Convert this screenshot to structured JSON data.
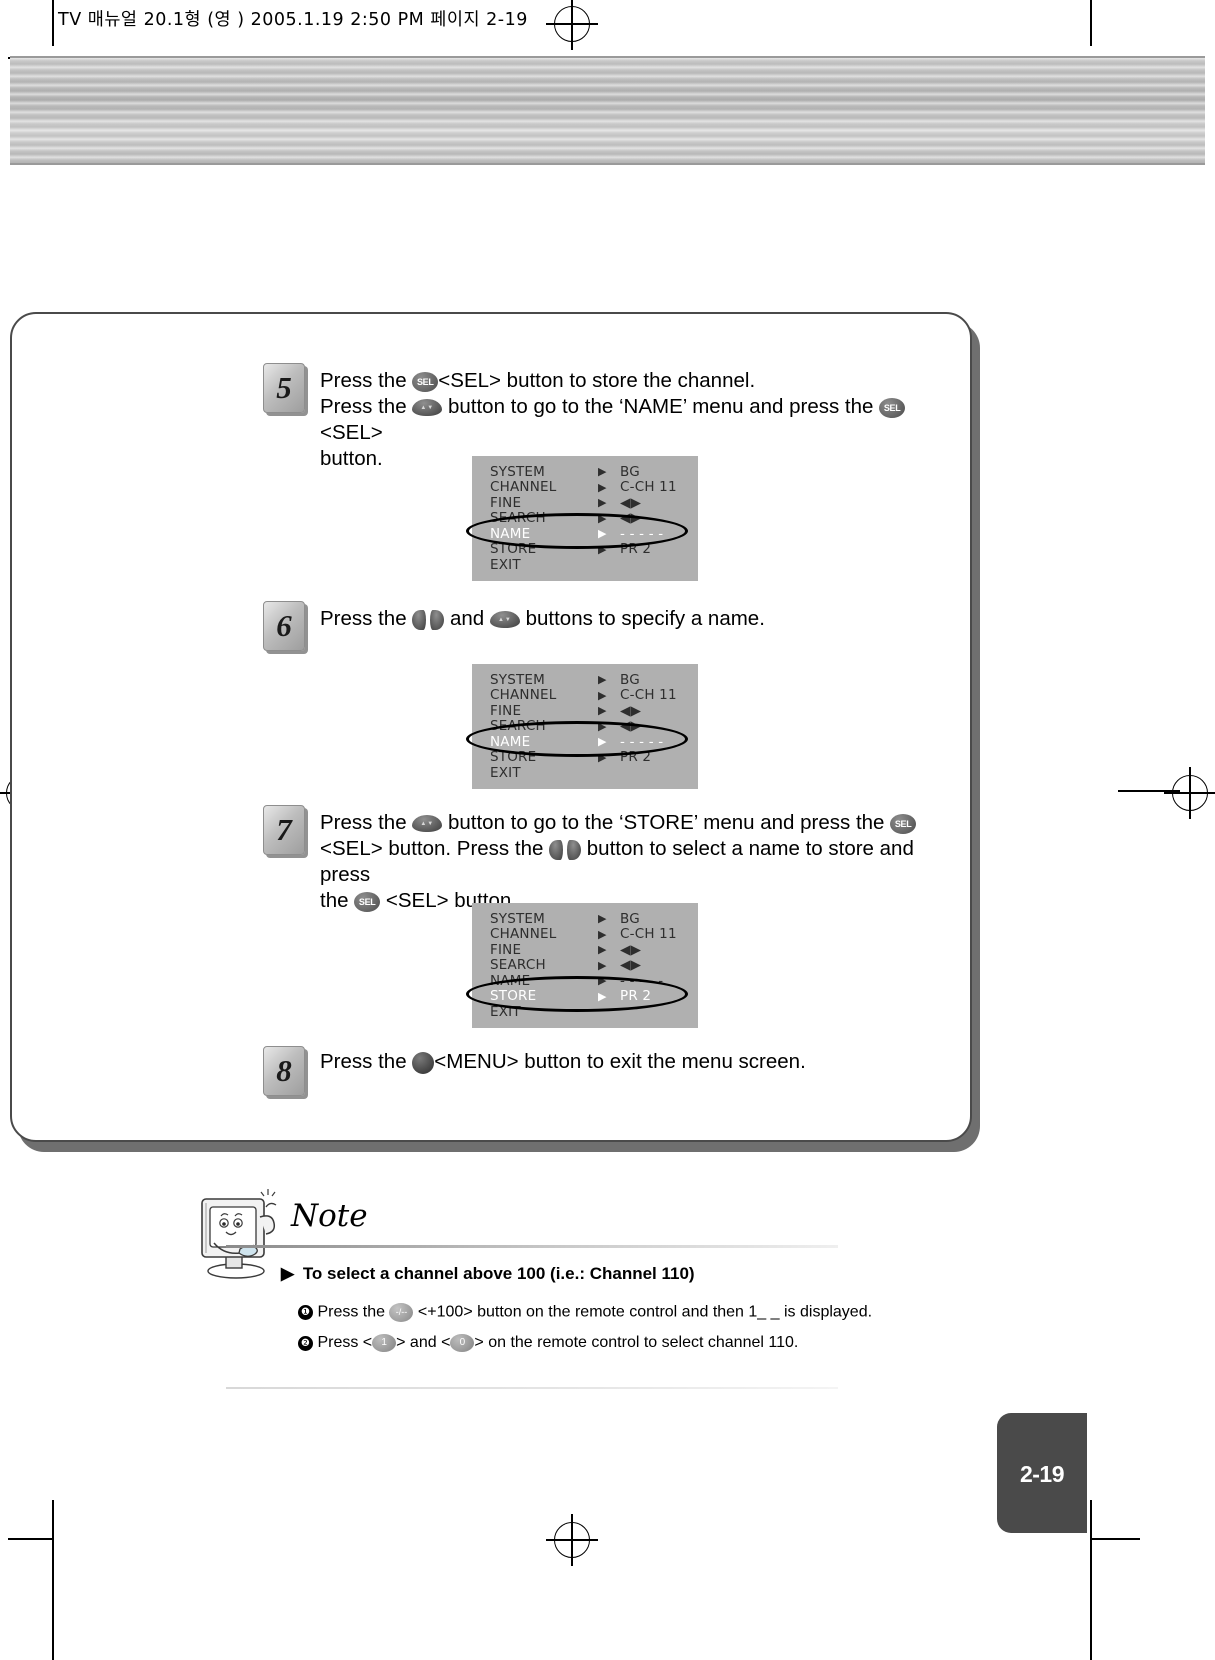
{
  "imposition": {
    "header": "TV 매뉴얼 20.1형 (영 )  2005.1.19 2:50 PM  페이지 2-19"
  },
  "page": {
    "number": "2-19"
  },
  "steps": [
    {
      "badge": "5",
      "lines": [
        {
          "parts": [
            {
              "t": "text",
              "v": "Press the "
            },
            {
              "t": "key",
              "v": "sel"
            },
            {
              "t": "text",
              "v": "<SEL> button to store the channel."
            }
          ]
        },
        {
          "parts": [
            {
              "t": "text",
              "v": "Press the "
            },
            {
              "t": "key",
              "v": "updown"
            },
            {
              "t": "text",
              "v": " button to go to the ‘NAME’ menu and press the "
            },
            {
              "t": "key",
              "v": "sel"
            },
            {
              "t": "text",
              "v": "<SEL>"
            }
          ]
        },
        {
          "parts": [
            {
              "t": "text",
              "v": "button."
            }
          ]
        }
      ]
    },
    {
      "badge": "6",
      "lines": [
        {
          "parts": [
            {
              "t": "text",
              "v": "Press the "
            },
            {
              "t": "key",
              "v": "lr"
            },
            {
              "t": "text",
              "v": " and "
            },
            {
              "t": "key",
              "v": "updown"
            },
            {
              "t": "text",
              "v": " buttons to specify a name."
            }
          ]
        }
      ]
    },
    {
      "badge": "7",
      "lines": [
        {
          "parts": [
            {
              "t": "text",
              "v": "Press the "
            },
            {
              "t": "key",
              "v": "updown"
            },
            {
              "t": "text",
              "v": " button to go to the ‘STORE’ menu and press the "
            },
            {
              "t": "key",
              "v": "sel"
            }
          ]
        },
        {
          "parts": [
            {
              "t": "text",
              "v": "<SEL> button. Press the "
            },
            {
              "t": "key",
              "v": "lr"
            },
            {
              "t": "text",
              "v": " button to select a name to store and press"
            }
          ]
        },
        {
          "parts": [
            {
              "t": "text",
              "v": "the "
            },
            {
              "t": "key",
              "v": "sel"
            },
            {
              "t": "text",
              "v": " <SEL> button."
            }
          ]
        }
      ]
    },
    {
      "badge": "8",
      "lines": [
        {
          "parts": [
            {
              "t": "text",
              "v": "Press the "
            },
            {
              "t": "key",
              "v": "menu"
            },
            {
              "t": "text",
              "v": "<MENU> button to exit the menu screen."
            }
          ]
        }
      ]
    }
  ],
  "osd_menus": [
    {
      "id": "osd-name-1",
      "selected": "NAME",
      "rows": [
        {
          "label": "SYSTEM",
          "arrow": "▶",
          "value": "BG"
        },
        {
          "label": "CHANNEL",
          "arrow": "▶",
          "value": "C-CH 11"
        },
        {
          "label": "FINE",
          "arrow": "▶",
          "value": "◀▶"
        },
        {
          "label": "SEARCH",
          "arrow": "▶",
          "value": "◀▶"
        },
        {
          "label": "NAME",
          "arrow": "▶",
          "value": "- - - - -"
        },
        {
          "label": "STORE",
          "arrow": "▶",
          "value": "PR 2"
        },
        {
          "label": "EXIT",
          "arrow": "",
          "value": ""
        }
      ]
    },
    {
      "id": "osd-name-2",
      "selected": "NAME",
      "rows": [
        {
          "label": "SYSTEM",
          "arrow": "▶",
          "value": "BG"
        },
        {
          "label": "CHANNEL",
          "arrow": "▶",
          "value": "C-CH 11"
        },
        {
          "label": "FINE",
          "arrow": "▶",
          "value": "◀▶"
        },
        {
          "label": "SEARCH",
          "arrow": "▶",
          "value": "◀▶"
        },
        {
          "label": "NAME",
          "arrow": "▶",
          "value": "- - - - -"
        },
        {
          "label": "STORE",
          "arrow": "▶",
          "value": "PR 2"
        },
        {
          "label": "EXIT",
          "arrow": "",
          "value": ""
        }
      ]
    },
    {
      "id": "osd-store",
      "selected": "STORE",
      "rows": [
        {
          "label": "SYSTEM",
          "arrow": "▶",
          "value": "BG"
        },
        {
          "label": "CHANNEL",
          "arrow": "▶",
          "value": "C-CH 11"
        },
        {
          "label": "FINE",
          "arrow": "▶",
          "value": "◀▶"
        },
        {
          "label": "SEARCH",
          "arrow": "▶",
          "value": "◀▶"
        },
        {
          "label": "NAME",
          "arrow": "▶",
          "value": "- - - - -"
        },
        {
          "label": "STORE",
          "arrow": "▶",
          "value": "PR 2"
        },
        {
          "label": "EXIT",
          "arrow": "",
          "value": ""
        }
      ]
    }
  ],
  "note": {
    "title": "Note",
    "heading_marker": "▶",
    "heading": "To select a channel above 100 (i.e.: Channel 110)",
    "items": [
      {
        "num": "❶",
        "parts": [
          {
            "t": "text",
            "v": "Press the "
          },
          {
            "t": "key",
            "v": "plus100",
            "v2": "-/--"
          },
          {
            "t": "text",
            "v": " <+100> button on the remote control and then 1_ _ is displayed."
          }
        ]
      },
      {
        "num": "❷",
        "parts": [
          {
            "t": "text",
            "v": "Press <"
          },
          {
            "t": "key",
            "v": "num",
            "v2": "1"
          },
          {
            "t": "text",
            "v": "> and <"
          },
          {
            "t": "key",
            "v": "num",
            "v2": "0"
          },
          {
            "t": "text",
            "v": "> on the remote control to select channel 110."
          }
        ]
      }
    ]
  },
  "colors": {
    "osd_bg": "#b0b0b0",
    "osd_text": "#2e2e2e",
    "osd_selected_text": "#ffffff",
    "panel_border": "#4a4a4a",
    "page_tab_bg": "#4a4a4a",
    "band_gray": "#bdbdbd"
  }
}
